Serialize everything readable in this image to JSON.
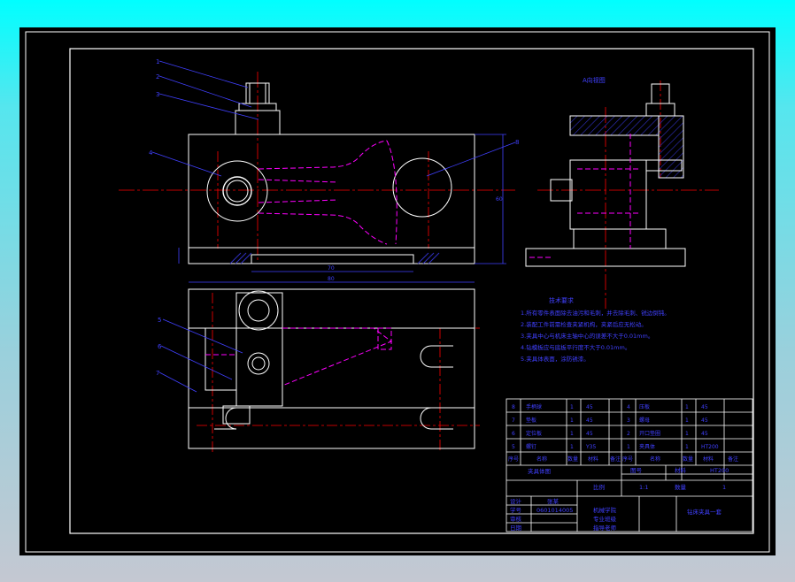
{
  "colors": {
    "background": "#000000",
    "frame": "#ffffff",
    "center_line": "#ff0000",
    "hidden_line": "#ff00ff",
    "dimension": "#4040ff",
    "note_text": "#4040ff",
    "hatch": "#3030c0"
  },
  "views": {
    "side_view_label": "A向视图",
    "callouts": [
      "1",
      "2",
      "3",
      "4",
      "8",
      "5",
      "6",
      "7"
    ]
  },
  "dimensions": {
    "top_width": "70",
    "base_width": "80",
    "height_right": "60"
  },
  "notes": {
    "title": "技术要求",
    "lines": [
      "1.所有零件表面除去油污和毛刺，并去除毛刺、锐边倒钝。",
      "2.装配工件前需检查夹紧机构，夹紧后应无松动。",
      "3.夹具中心与机床主轴中心的误差不大于0.01mm。",
      "4.钻模板应与底板平行度不大于0.01mm。",
      "5.夹具体表面，涂防锈漆。"
    ]
  },
  "parts_table": {
    "rows": [
      [
        "8",
        "手柄球",
        "1",
        "45",
        "",
        "4",
        "压板",
        "1",
        "45",
        ""
      ],
      [
        "7",
        "垫板",
        "1",
        "45",
        "",
        "3",
        "螺母",
        "1",
        "45",
        ""
      ],
      [
        "6",
        "定位板",
        "1",
        "45",
        "",
        "2",
        "开口垫圈",
        "1",
        "45",
        ""
      ],
      [
        "5",
        "螺钉",
        "1",
        "Y35",
        "",
        "1",
        "夹具体",
        "1",
        "HT200",
        ""
      ]
    ],
    "header": [
      "序号",
      "名称",
      "数量",
      "材料",
      "备注",
      "序号",
      "名称",
      "数量",
      "材料",
      "备注"
    ]
  },
  "title_block": {
    "drawing_name": "夹具体图",
    "scale_label": "比例",
    "scale": "1:1",
    "sheet_label": "图号",
    "sheet": "1",
    "qty_label": "数量",
    "material_label": "材料",
    "material": "HT200",
    "designer_label": "设计",
    "designer": "张某",
    "student_id_label": "学号",
    "student_id": "0601014005",
    "check_label": "审核",
    "date_label": "日期",
    "school_lines": [
      "机械学院",
      "专业班级",
      "指导老师"
    ],
    "part_name": "钻床夹具一套"
  }
}
